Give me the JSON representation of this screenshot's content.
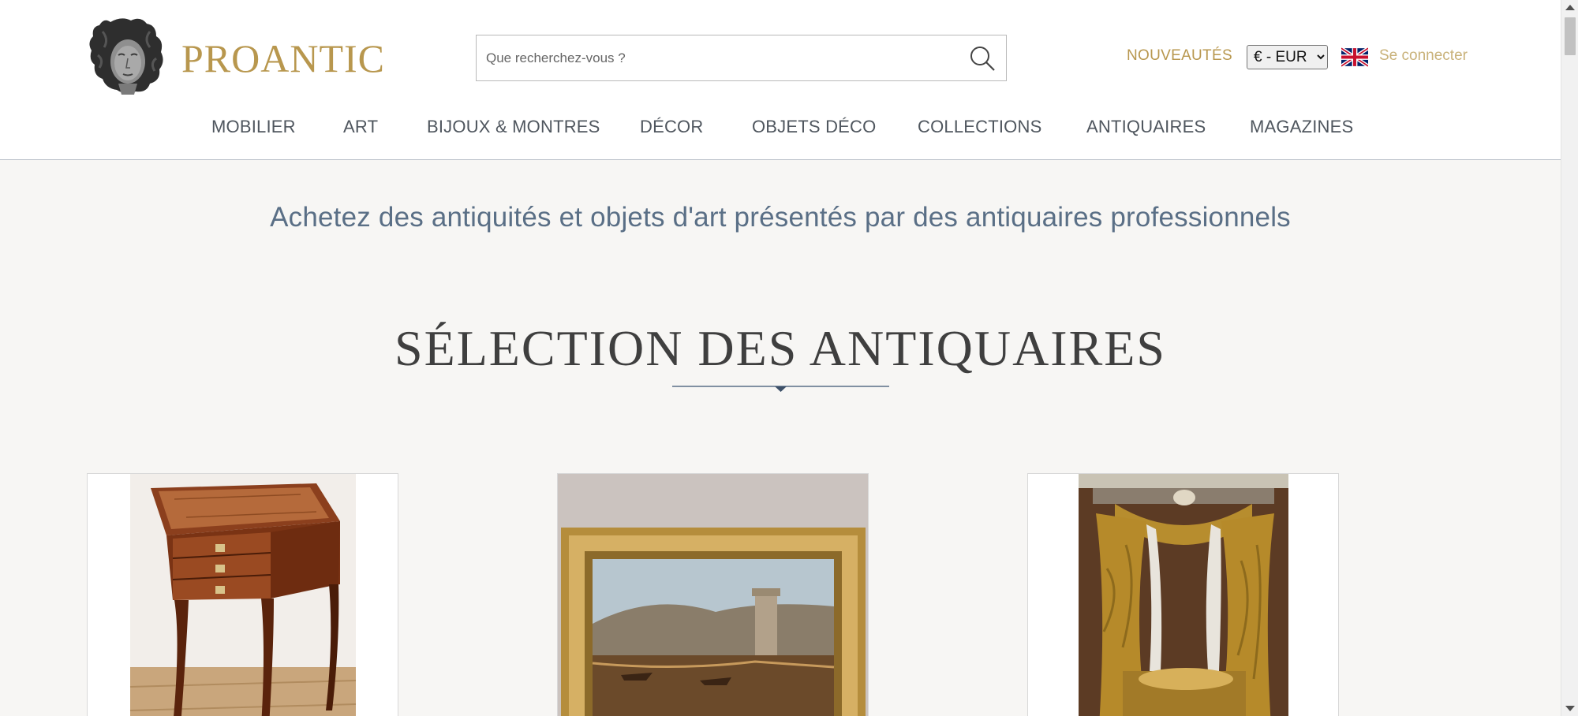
{
  "header": {
    "logo_text": "PROANTIC",
    "search_placeholder": "Que recherchez-vous ?",
    "nouveautes_label": "NOUVEAUTÉS",
    "currency_selected": "€ - EUR",
    "login_label": "Se connecter"
  },
  "nav": {
    "items": [
      "MOBILIER",
      "ART",
      "BIJOUX & MONTRES",
      "DÉCOR",
      "OBJETS DÉCO",
      "COLLECTIONS",
      "ANTIQUAIRES",
      "MAGAZINES"
    ]
  },
  "main": {
    "tagline": "Achetez des antiquités et objets d'art présentés par des antiquaires professionnels",
    "section_title": "SÉLECTION DES ANTIQUAIRES"
  },
  "colors": {
    "brand_gold": "#b8974e",
    "nav_text": "#4f565e",
    "tagline_blue": "#5a6f86",
    "page_bg": "#f7f6f4"
  }
}
